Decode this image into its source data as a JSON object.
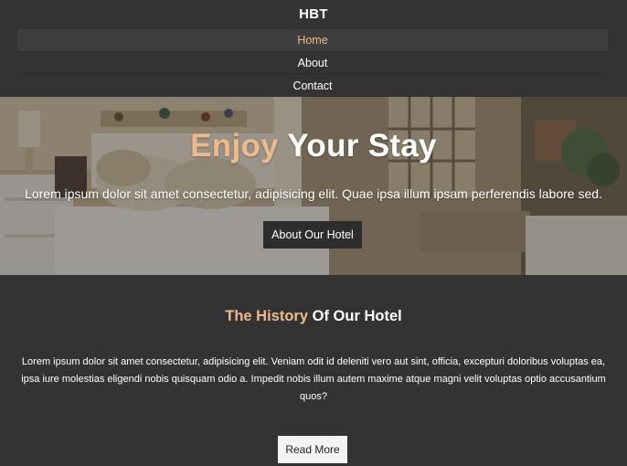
{
  "header": {
    "brand": "HBT",
    "nav": [
      {
        "label": "Home",
        "active": true
      },
      {
        "label": "About",
        "active": false
      },
      {
        "label": "Contact",
        "active": false
      }
    ]
  },
  "hero": {
    "title_accent": "Enjoy",
    "title_rest": " Your Stay",
    "text": "Lorem ipsum dolor sit amet consectetur, adipisicing elit. Quae ipsa illum ipsam perferendis labore sed.",
    "button_label": "About Our Hotel"
  },
  "history": {
    "title_accent": "The History",
    "title_rest": " Of Our Hotel",
    "text": "Lorem ipsum dolor sit amet consectetur, adipisicing elit. Veniam odit id deleniti vero aut sint, officia, excepturi doloribus voluptas ea, ipsa iure molestias eligendi nobis quisquam odio a. Impedit nobis illum autem maxime atque magni velit voluptas optio accusantium quos?",
    "button_label": "Read More"
  },
  "colors": {
    "background": "#333333",
    "accent": "#f0b98a",
    "text": "#ffffff"
  }
}
